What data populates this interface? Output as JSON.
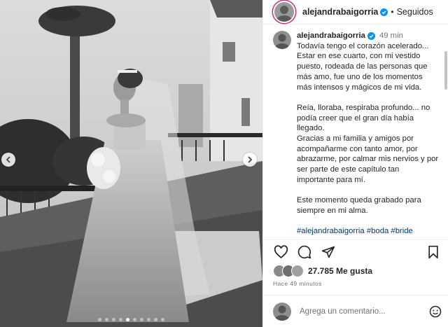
{
  "post": {
    "username": "alejandrabaigorria",
    "separator": "•",
    "follow_status": "Seguidos",
    "time_ago_short": "49 min",
    "caption_lines": [
      "Todavía tengo el corazón acelerado...",
      "Estar en ese cuarto, con mi vestido",
      "puesto, rodeada de las personas que",
      "más amo, fue uno de los momentos",
      "más intensos y mágicos de mi vida.",
      "",
      "Reía, lloraba, respiraba profundo... no",
      "podía creer que el gran día había",
      "llegado.",
      "Gracias a mi familia y amigos por",
      "acompañarme con tanto amor, por",
      "abrazarme, por calmar mis nervios y por",
      "ser parte de este capítulo tan",
      "importante para mí.",
      "",
      "Este momento queda grabado para",
      "siempre en mi alma.",
      ""
    ],
    "hashtags": "#alejandrabaigorria #boda #bride",
    "likes": "27.785 Me gusta",
    "time_ago_long": "Hace 49 minutos",
    "comment_placeholder": "Agrega un comentario...",
    "carousel": {
      "count": 10,
      "active_index": 4
    }
  },
  "colors": {
    "story_ring": "#d62976",
    "verified": "#0095f6",
    "hashtag": "#00376b",
    "muted": "#737373"
  },
  "icons": [
    "verified-badge-icon",
    "heart-icon",
    "comment-icon",
    "share-icon",
    "bookmark-icon",
    "emoji-icon",
    "chevron-left-icon",
    "chevron-right-icon"
  ]
}
